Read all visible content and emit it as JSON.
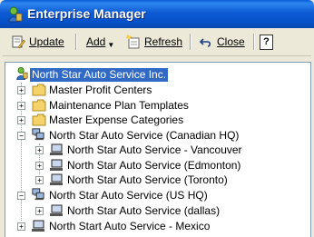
{
  "window": {
    "title": "Enterprise Manager"
  },
  "toolbar": {
    "update_label": "Update",
    "add_label": "Add",
    "refresh_label": "Refresh",
    "close_label": "Close",
    "help_label": "?"
  },
  "tree": {
    "root": "North Star Auto Service Inc.",
    "items": [
      "Master Profit Centers",
      "Maintenance Plan Templates",
      "Master Expense Categories",
      "North Star Auto Service (Canadian HQ)",
      "North Star Auto Service - Vancouver",
      "North Star Auto Service (Edmonton)",
      "North Star Auto Service (Toronto)",
      "North Star Auto Service (US HQ)",
      "North Star Auto Service (dallas)",
      "North Start Auto Service - Mexico"
    ]
  },
  "colors": {
    "titlebar": "#0a5fd8",
    "selection": "#316ac5",
    "folder": "#f5d36b"
  }
}
